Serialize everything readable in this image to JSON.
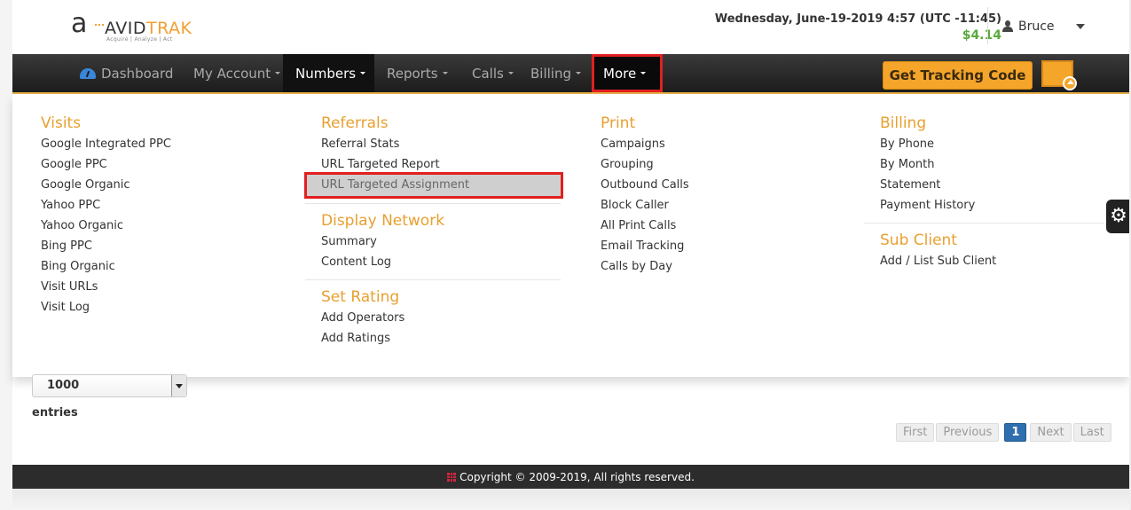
{
  "header": {
    "logo": {
      "brand_part1": "AVID",
      "brand_part2": "TRAK",
      "tagline": "Acquire  |  Analyze  |  Act"
    },
    "datetime": "Wednesday, June-19-2019 4:57 (UTC -11:45)",
    "balance": "$4.14",
    "user_name": "Bruce"
  },
  "nav": {
    "items": [
      {
        "label": "Dashboard",
        "icon": "dashboard-icon"
      },
      {
        "label": "My Account"
      },
      {
        "label": "Numbers",
        "active": true
      },
      {
        "label": "Reports"
      },
      {
        "label": "Calls"
      },
      {
        "label": "Billing"
      },
      {
        "label": "More",
        "highlighted": true
      }
    ],
    "tracking_button": "Get Tracking Code"
  },
  "mega_menu": {
    "visits": {
      "title": "Visits",
      "items": [
        "Google Integrated PPC",
        "Google PPC",
        "Google Organic",
        "Yahoo PPC",
        "Yahoo Organic",
        "Bing PPC",
        "Bing Organic",
        "Visit URLs",
        "Visit Log"
      ]
    },
    "referrals": {
      "title": "Referrals",
      "items": [
        "Referral Stats",
        "URL Targeted Report",
        "URL Targeted Assignment"
      ],
      "highlighted_item": "URL Targeted Assignment"
    },
    "display_network": {
      "title": "Display Network",
      "items": [
        "Summary",
        "Content Log"
      ]
    },
    "set_rating": {
      "title": "Set Rating",
      "items": [
        "Add Operators",
        "Add Ratings"
      ]
    },
    "print": {
      "title": "Print",
      "items": [
        "Campaigns",
        "Grouping",
        "Outbound Calls",
        "Block Caller",
        "All Print Calls",
        "Email Tracking",
        "Calls by Day"
      ]
    },
    "billing": {
      "title": "Billing",
      "items": [
        "By Phone",
        "By Month",
        "Statement",
        "Payment History"
      ]
    },
    "sub_client": {
      "title": "Sub Client",
      "items": [
        "Add / List Sub Client"
      ]
    }
  },
  "table_controls": {
    "page_length": "1000",
    "entries_label": "entries",
    "pagination": {
      "first": "First",
      "previous": "Previous",
      "current": "1",
      "next": "Next",
      "last": "Last"
    }
  },
  "footer": {
    "copyright": "Copyright © 2009-2019, All rights reserved."
  },
  "colors": {
    "accent": "#f5a52a",
    "section_title": "#e8a030",
    "balance": "#5aaa3a",
    "highlight_border": "#e02020",
    "pager_active": "#2f6fae"
  }
}
